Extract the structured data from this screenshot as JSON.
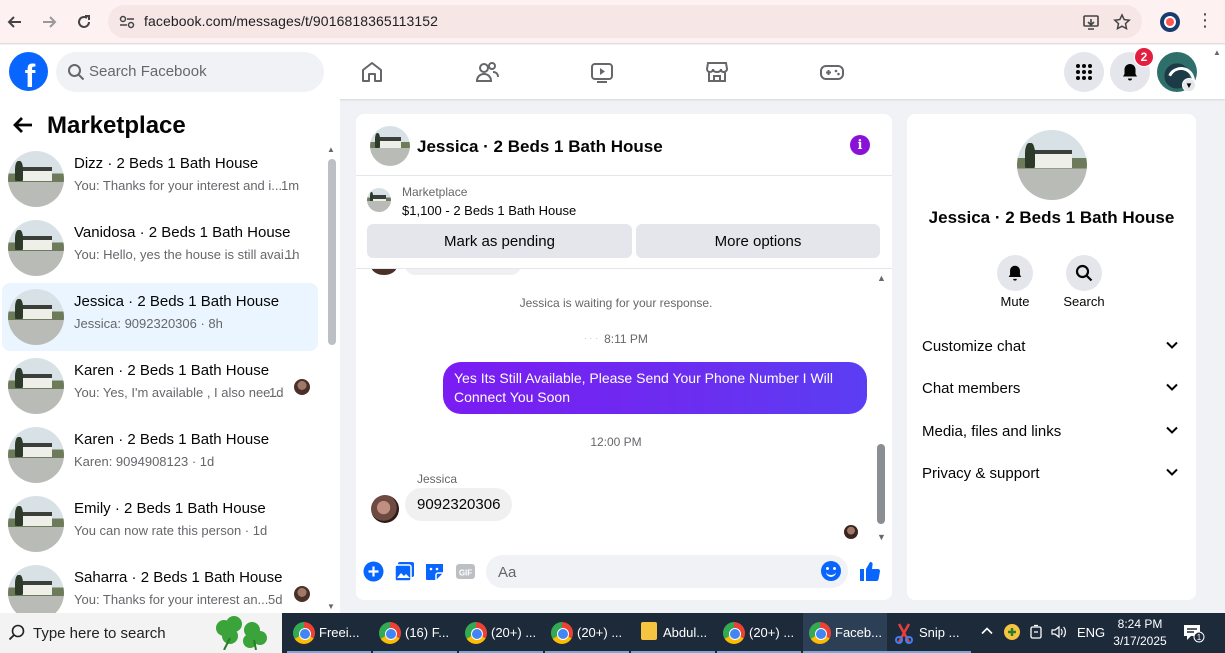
{
  "browser": {
    "url": "facebook.com/messages/t/9016818365113152"
  },
  "fbnav": {
    "search_placeholder": "Search Facebook",
    "notifications_count": "2"
  },
  "left": {
    "title": "Marketplace",
    "conversations": [
      {
        "name": "Dizz · 2 Beds 1 Bath House",
        "snippet": "You: Thanks for your interest and i...",
        "time": "1m"
      },
      {
        "name": "Vanidosa · 2 Beds 1 Bath House",
        "snippet": "You: Hello, yes the house is still avai...",
        "time": "1h"
      },
      {
        "name": "Jessica · 2 Beds 1 Bath House",
        "snippet": "Jessica: 9092320306 · 8h",
        "time": ""
      },
      {
        "name": "Karen · 2 Beds 1 Bath House",
        "snippet": "You: Yes, I'm available , I also nee...",
        "time": "1d"
      },
      {
        "name": "Karen · 2 Beds 1 Bath House",
        "snippet": "Karen: 9094908123 · 1d",
        "time": ""
      },
      {
        "name": "Emily · 2 Beds 1 Bath House",
        "snippet": "You can now rate this person · 1d",
        "time": ""
      },
      {
        "name": "Saharra · 2 Beds 1 Bath House",
        "snippet": "You: Thanks for your interest an...",
        "time": "5d"
      }
    ]
  },
  "chat": {
    "title": "Jessica · 2 Beds 1 Bath House",
    "listing_category": "Marketplace",
    "listing_price": "$1,100 - 2 Beds 1 Bath House",
    "mark_pending": "Mark as pending",
    "more_options": "More options",
    "waiting_text": "Jessica is waiting for your response.",
    "time1": "8:11 PM",
    "outgoing_msg": "Yes Its Still Available, Please Send Your Phone Number I Will Connect You Soon",
    "time2": "12:00 PM",
    "sender": "Jessica",
    "incoming_msg": "9092320306",
    "composer_placeholder": "Aa"
  },
  "right": {
    "name": "Jessica · 2 Beds 1 Bath House",
    "mute": "Mute",
    "search": "Search",
    "sections": [
      "Customize chat",
      "Chat members",
      "Media, files and links",
      "Privacy & support"
    ]
  },
  "taskbar": {
    "search_placeholder": "Type here to search",
    "apps": [
      "Freei...",
      "(16) F...",
      "(20+) ...",
      "(20+) ...",
      "Abdul...",
      "(20+) ...",
      "Faceb...",
      "Snip ..."
    ],
    "lang": "ENG",
    "time": "8:24 PM",
    "date": "3/17/2025",
    "notif_count": "1"
  },
  "colors": {
    "fb_blue": "#0866ff",
    "accent_purple": "#8a12d8",
    "active_conv": "#ebf5ff",
    "badge_red": "#e41e3f"
  }
}
